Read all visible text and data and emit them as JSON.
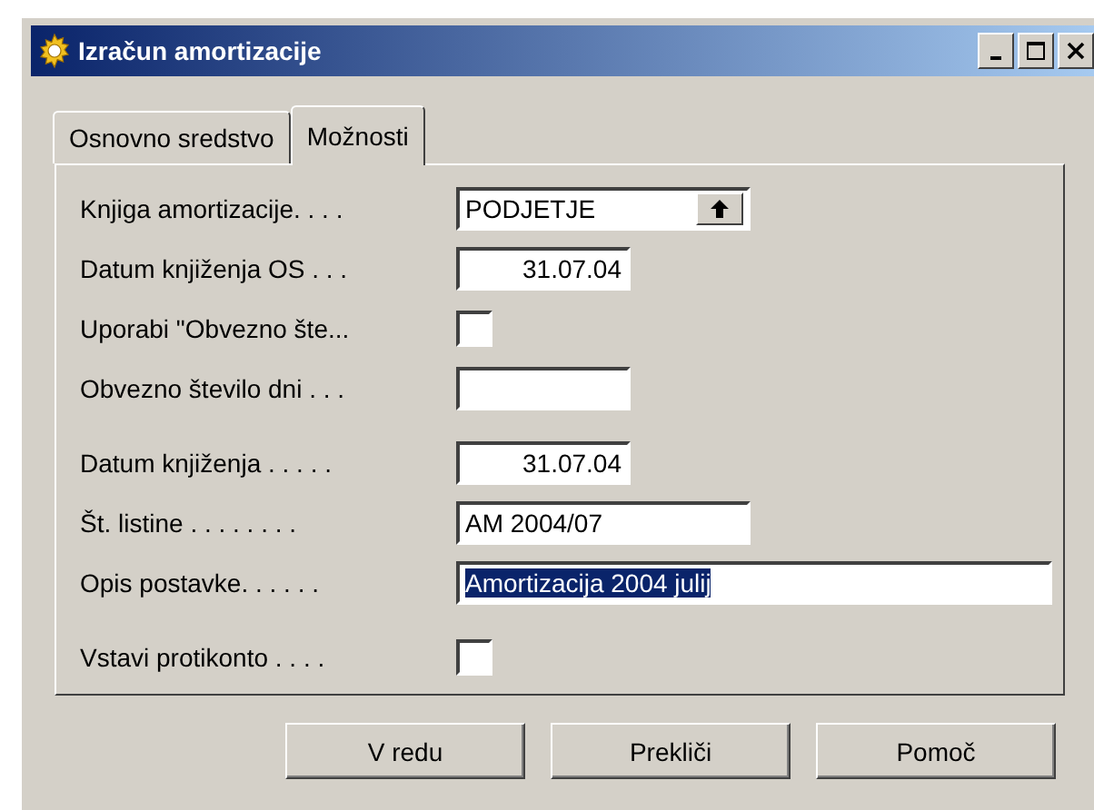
{
  "window": {
    "title": "Izračun amortizacije"
  },
  "tabs": [
    {
      "label": "Osnovno sredstvo",
      "selected": false
    },
    {
      "label": "Možnosti",
      "selected": true
    }
  ],
  "field_groups": [
    [
      {
        "kind": "lookup",
        "label": "Knjiga amortizacije. . . .",
        "value": "PODJETJE"
      },
      {
        "kind": "date",
        "label": "Datum knjiženja OS . . .",
        "value": "31.07.04"
      },
      {
        "kind": "checkbox",
        "label": "Uporabi \"Obvezno šte...",
        "checked": false
      },
      {
        "kind": "short",
        "label": "Obvezno število dni . . ."
      }
    ],
    [
      {
        "kind": "date",
        "label": "Datum knjiženja . . . . .",
        "value": "31.07.04"
      },
      {
        "kind": "text",
        "label": "Št. listine . . . . . . . .",
        "value": "AM 2004/07"
      },
      {
        "kind": "long",
        "label": "Opis postavke. . . . . .",
        "value": "Amortizacija 2004 julij",
        "selected": true
      }
    ],
    [
      {
        "kind": "checkbox",
        "label": "Vstavi protikonto . . . .",
        "checked": false
      }
    ]
  ],
  "buttons": [
    "V redu",
    "Prekliči",
    "Pomoč"
  ]
}
